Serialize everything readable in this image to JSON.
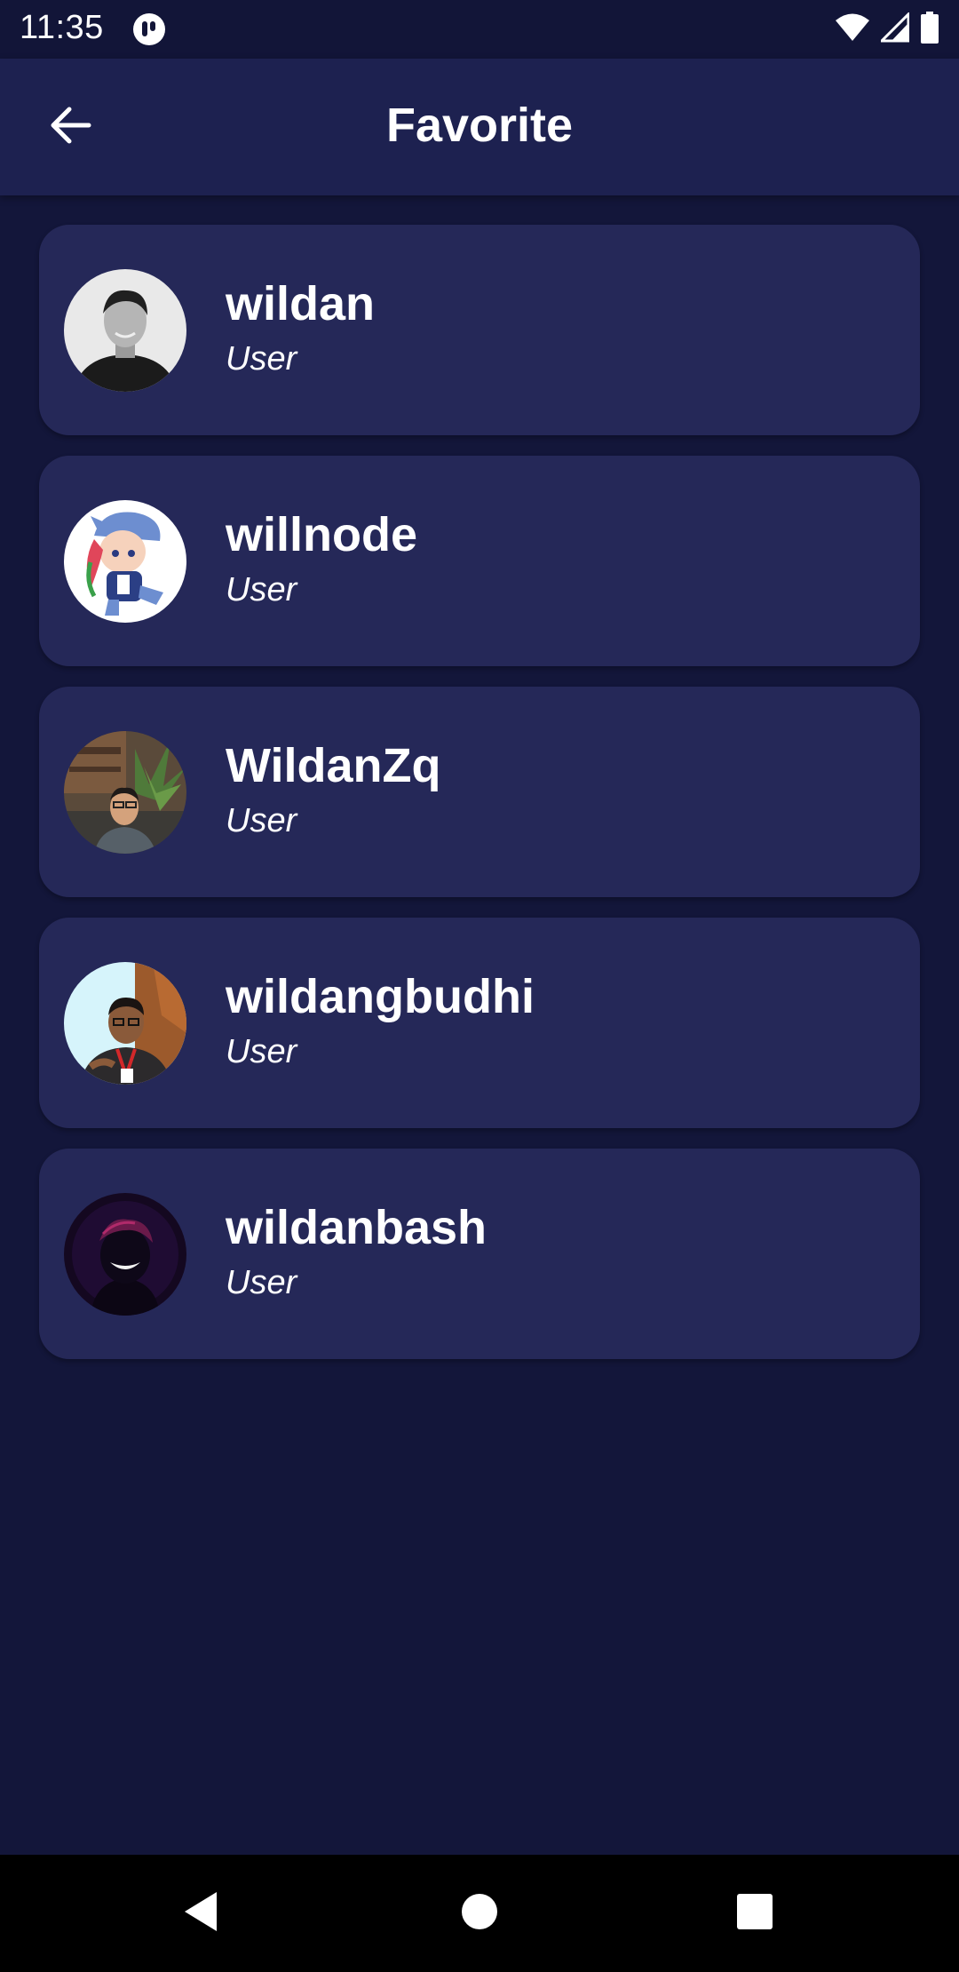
{
  "status_bar": {
    "time": "11:35",
    "icons": [
      "app-notification-icon",
      "wifi-icon",
      "cellular-signal-icon",
      "battery-icon"
    ]
  },
  "app_bar": {
    "title": "Favorite",
    "back_icon": "arrow-left-icon"
  },
  "favorites": [
    {
      "name": "wildan",
      "role": "User",
      "avatar": "grayscale-portrait"
    },
    {
      "name": "willnode",
      "role": "User",
      "avatar": "anime-character-blue-hat"
    },
    {
      "name": "WildanZq",
      "role": "User",
      "avatar": "portrait-with-plants"
    },
    {
      "name": "wildangbudhi",
      "role": "User",
      "avatar": "portrait-speaker"
    },
    {
      "name": "wildanbash",
      "role": "User",
      "avatar": "dark-smiling-figure"
    }
  ],
  "nav_bar": {
    "buttons": [
      "back-triangle-icon",
      "home-circle-icon",
      "recents-square-icon"
    ]
  },
  "colors": {
    "background": "#13163a",
    "app_bar": "#1d2150",
    "card": "#252858",
    "text": "#ffffff"
  }
}
